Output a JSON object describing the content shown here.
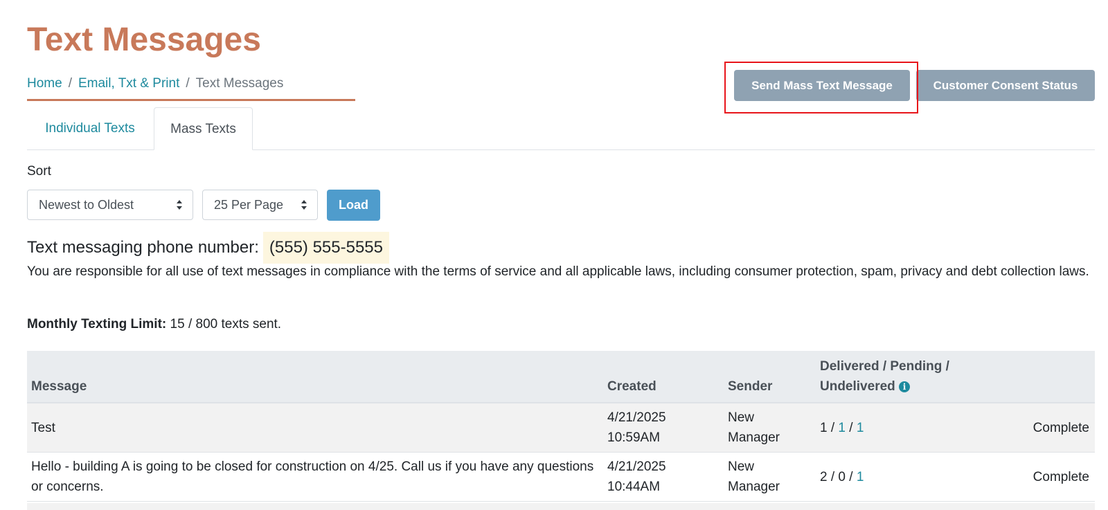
{
  "page": {
    "title": "Text Messages"
  },
  "breadcrumb": {
    "home": "Home",
    "section": "Email, Txt & Print",
    "current": "Text Messages",
    "separator": "/"
  },
  "actions": {
    "send_mass": "Send Mass Text Message",
    "consent_status": "Customer Consent Status"
  },
  "tabs": [
    {
      "label": "Individual Texts",
      "active": false
    },
    {
      "label": "Mass Texts",
      "active": true
    }
  ],
  "sort": {
    "label": "Sort",
    "order_value": "Newest to Oldest",
    "per_page_value": "25 Per Page",
    "load_label": "Load"
  },
  "phone": {
    "label": "Text messaging phone number:",
    "number": "(555) 555-5555"
  },
  "disclaimer": "You are responsible for all use of text messages in compliance with the terms of service and all applicable laws, including consumer protection, spam, privacy and debt collection laws.",
  "limit": {
    "label": "Monthly Texting Limit:",
    "value": "15 / 800 texts sent."
  },
  "table": {
    "headers": {
      "message": "Message",
      "created": "Created",
      "sender": "Sender",
      "stats": "Delivered / Pending / Undelivered",
      "status": ""
    },
    "rows": [
      {
        "message": "Test",
        "created_date": "4/21/2025",
        "created_time": "10:59AM",
        "sender_first": "New",
        "sender_last": "Manager",
        "delivered": "1",
        "pending": "1",
        "undelivered": "1",
        "status": "Complete"
      },
      {
        "message": "Hello - building A is going to be closed for construction on 4/25. Call us if you have any questions or concerns.",
        "created_date": "4/21/2025",
        "created_time": "10:44AM",
        "sender_first": "New",
        "sender_last": "Manager",
        "delivered": "2",
        "pending": "0",
        "undelivered": "1",
        "status": "Complete"
      }
    ]
  },
  "colors": {
    "title": "#c8795a",
    "link": "#1e8a9e",
    "button_gray": "#8fa2b2",
    "button_load": "#4f9ccc",
    "highlight": "#e8141a"
  }
}
